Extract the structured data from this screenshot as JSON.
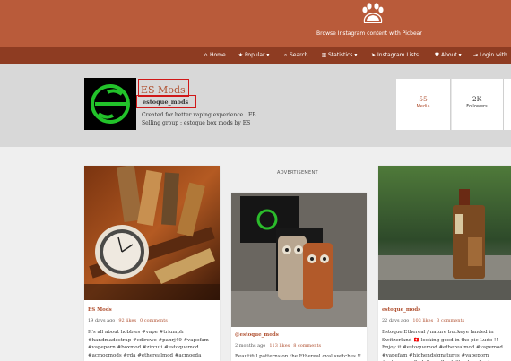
{
  "header": {
    "tagline": "Browse Instagram content with Picbear"
  },
  "nav": {
    "items": [
      {
        "icon": "home-icon",
        "label": "Home"
      },
      {
        "icon": "star-icon",
        "label": "Popular ▾"
      },
      {
        "icon": "search-icon",
        "label": "Search"
      },
      {
        "icon": "bar-chart-icon",
        "label": "Statistics ▾"
      },
      {
        "icon": "send-icon",
        "label": "Instagram Lists"
      },
      {
        "icon": "heart-icon",
        "label": "About ▾"
      },
      {
        "icon": "login-icon",
        "label": "Login with"
      }
    ]
  },
  "profile": {
    "name": "ES Mods",
    "username": "estoque_mods",
    "bio_line1": "Created for better vaping experience . FB",
    "bio_line2": "Selling group : estoque box mods by ES",
    "stats": [
      {
        "value": "55",
        "label": "Media"
      },
      {
        "value": "2K",
        "label": "Followers"
      }
    ]
  },
  "advert_label": "ADVERTISEMENT",
  "posts": [
    {
      "author": "ES Mods",
      "date": "19 days ago",
      "likes": "92 likes",
      "comments": "0 comments",
      "caption": "It's all about hobbies #vape #triumph #handmadestrap #cdirewe #panrj49 #vapefam #vapeporn #boxmod #zircuti #estoquemod #acmoomods #rda #etherealmod #acmoeda"
    },
    {
      "author": "@estoque_mods",
      "date": "2 months ago",
      "likes": "113 likes",
      "comments": "8 comments",
      "caption": "Beautiful patterns on the Ethereal oval switches !!"
    },
    {
      "author": "estoque_mods",
      "date": "22 days ago",
      "likes": "103 likes",
      "comments": "3 comments",
      "caption": "Estoque Ethereal / nature buckeye landed in Switzerland 🇨🇭 looking good in the pic Ludo !! Enjoy it #estoquemod #etherealmod #vapemod #vapefam #highendsignatures #vapeporn #estoquecrafted #woodburl #buckeyeburl"
    }
  ],
  "colors": {
    "brand_top": "#b95b3a",
    "brand_nav": "#8e3c22",
    "accent_text": "#b05030",
    "highlight_box": "#d01818"
  }
}
